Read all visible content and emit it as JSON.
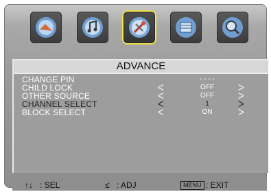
{
  "panel": {
    "title": "ADVANCE"
  },
  "rows": [
    {
      "label": "CHANGE PIN",
      "value": "- - - -",
      "arrows": false,
      "active": false
    },
    {
      "label": "CHILD LOCK",
      "value": "OFF",
      "arrows": true,
      "active": false
    },
    {
      "label": "OTHER SOURCE",
      "value": "OFF",
      "arrows": true,
      "active": false
    },
    {
      "label": "CHANNEL SELECT",
      "value": "1",
      "arrows": true,
      "active": true
    },
    {
      "label": "BLOCK SELECT",
      "value": "ON",
      "arrows": true,
      "active": false
    }
  ],
  "arrows": {
    "left": "ᐸ",
    "right": "ᐳ"
  },
  "footer": {
    "sel_glyph": "↑↓",
    "sel_label": ": SEL",
    "adj_glyph": "≤",
    "adj_label": ": ADJ",
    "menu_key": "MENU",
    "exit_label": ": EXIT"
  },
  "icons": [
    "picture-icon",
    "sound-icon",
    "setup-icon",
    "channel-icon",
    "search-icon"
  ],
  "colors": {
    "accent": "#f2e34a",
    "bg": "#9d9d9d",
    "title_bg": "#d7d7d7",
    "text": "#ffffff"
  }
}
